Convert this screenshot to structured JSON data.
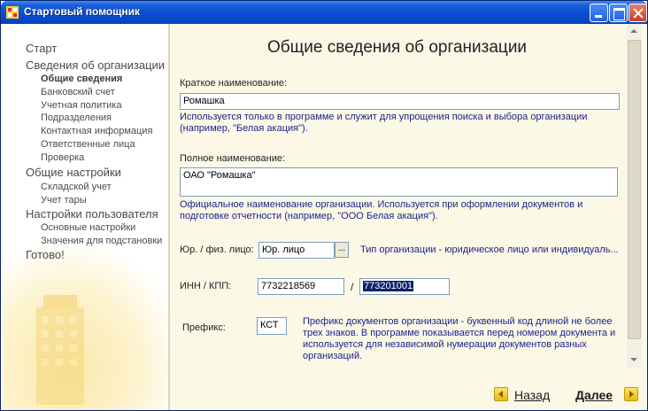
{
  "window": {
    "title": "Стартовый помощник"
  },
  "sidebar": {
    "items": [
      {
        "label": "Старт",
        "level": 1
      },
      {
        "label": "Сведения об организации",
        "level": 1
      },
      {
        "label": "Общие сведения",
        "level": 2,
        "active": true
      },
      {
        "label": "Банковский счет",
        "level": 2
      },
      {
        "label": "Учетная политика",
        "level": 2
      },
      {
        "label": "Подразделения",
        "level": 2
      },
      {
        "label": "Контактная информация",
        "level": 2
      },
      {
        "label": "Ответственные лица",
        "level": 2
      },
      {
        "label": "Проверка",
        "level": 2
      },
      {
        "label": "Общие настройки",
        "level": 1
      },
      {
        "label": "Складской учет",
        "level": 2
      },
      {
        "label": "Учет тары",
        "level": 2
      },
      {
        "label": "Настройки пользователя",
        "level": 1
      },
      {
        "label": "Основные настройки",
        "level": 2
      },
      {
        "label": "Значения для подстановки",
        "level": 2
      },
      {
        "label": "Готово!",
        "level": 1
      }
    ]
  },
  "main": {
    "title": "Общие сведения об организации",
    "short_name": {
      "label": "Краткое наименование:",
      "value": "Ромашка",
      "hint": "Используется только в программе и служит для упрощения поиска и выбора организации (например, \"Белая акация\")."
    },
    "full_name": {
      "label": "Полное наименование:",
      "value": "ОАО \"Ромашка\"",
      "hint": "Официальное наименование организации. Используется при оформлении документов и подготовке отчетности (например, \"ООО Белая акация\")."
    },
    "entity_type": {
      "label": "Юр. / физ. лицо:",
      "value": "Юр. лицо",
      "select_button": "...",
      "hint": "Тип организации - юридическое лицо или индивидуаль..."
    },
    "inn_kpp": {
      "label": "ИНН / КПП:",
      "inn": "7732218569",
      "separator": "/",
      "kpp": "773201001"
    },
    "prefix": {
      "label": "Префикс:",
      "value": "КСТ",
      "hint": "Префикс документов организации - буквенный код длиной не более трех знаков. В программе показывается перед номером документа и используется для независимой нумерации документов разных организаций."
    }
  },
  "footer": {
    "back_label": "Назад",
    "next_label": "Далее"
  },
  "icons": {
    "back": "arrow-left-icon",
    "next": "arrow-right-icon"
  },
  "colors": {
    "titlebar": "#0a4fd3",
    "background": "#fbf8e6",
    "hint_text": "#1a1f8c",
    "selection": "#0a246a",
    "nav_arrow": "#f0c419"
  }
}
